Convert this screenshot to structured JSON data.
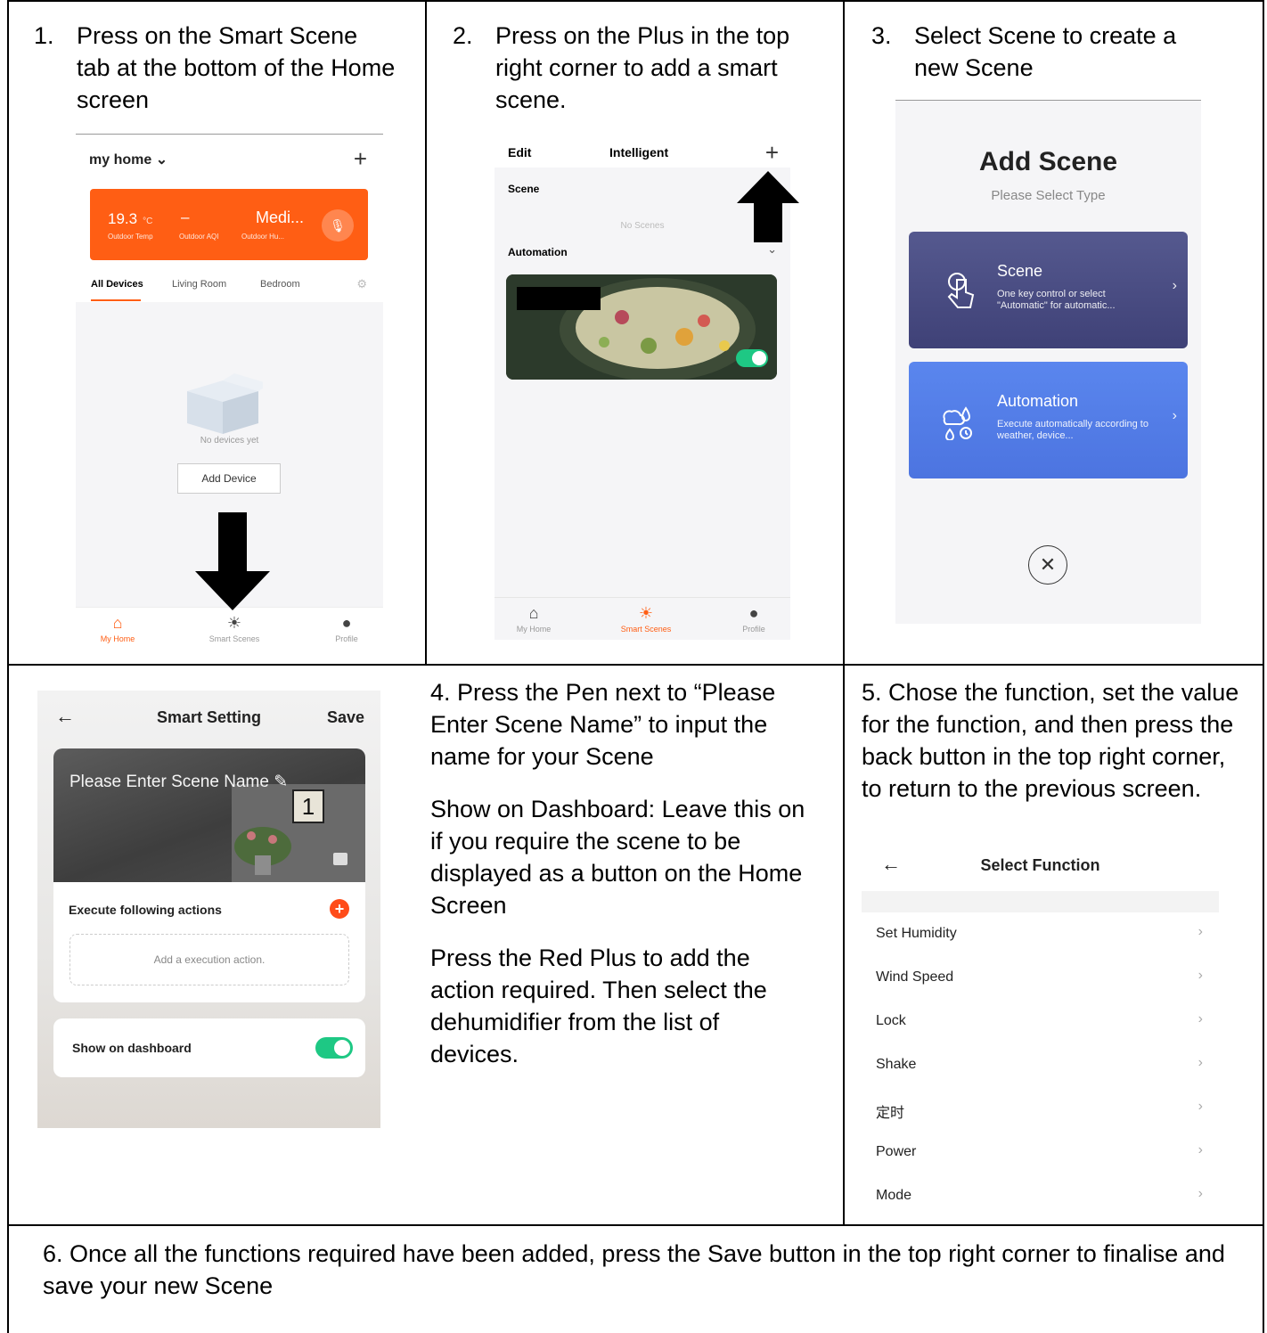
{
  "steps": {
    "s1": {
      "num": "1.",
      "text": "Press on the Smart Scene tab at the bottom of the Home screen"
    },
    "s2": {
      "num": "2.",
      "text": "Press on the Plus in the top right corner to add a smart scene."
    },
    "s3": {
      "num": "3.",
      "text": "Select Scene to create a new Scene"
    },
    "s4": {
      "p1": "4. Press the Pen next to “Please Enter Scene Name” to input the name for your Scene",
      "p2": "Show on Dashboard: Leave this on if you require the scene to be displayed as a button on the Home Screen",
      "p3": "Press the Red Plus to add the action required.  Then select the dehumidifier from the list of devices."
    },
    "s5": {
      "text": "5. Chose the function, set the value for the function, and then press the back button in the top right corner, to return to the previous screen."
    },
    "s6": {
      "text": "6.  Once all the functions required have been added, press the Save button in the top right corner to finalise and save your new Scene"
    }
  },
  "screen1": {
    "home_title": "my home",
    "temp": "19.3",
    "temp_unit": "°C",
    "aqi": "–",
    "humidity": "Medi...",
    "temp_label": "Outdoor Temp",
    "aqi_label": "Outdoor AQI",
    "hum_label": "Outdoor Hu...",
    "tabs": [
      "All Devices",
      "Living Room",
      "Bedroom"
    ],
    "empty_text": "No devices yet",
    "add_device": "Add Device",
    "nav": [
      "My Home",
      "Smart Scenes",
      "Profile"
    ]
  },
  "screen2": {
    "edit": "Edit",
    "title": "Intelligent",
    "scene_label": "Scene",
    "no_scenes": "No Scenes",
    "automation_label": "Automation",
    "nav": [
      "My Home",
      "Smart Scenes",
      "Profile"
    ]
  },
  "screen3": {
    "title": "Add Scene",
    "subtitle": "Please Select Type",
    "scene": {
      "name": "Scene",
      "desc": "One key control or select \"Automatic\" for automatic..."
    },
    "automation": {
      "name": "Automation",
      "desc": "Execute automatically according to weather, device..."
    }
  },
  "screen4": {
    "title": "Smart Setting",
    "save": "Save",
    "name_placeholder": "Please Enter Scene Name",
    "calendar_digit": "1",
    "execute_label": "Execute following actions",
    "add_action": "Add a execution action.",
    "dashboard_label": "Show on dashboard"
  },
  "screen5": {
    "title": "Select Function",
    "functions": [
      "Set Humidity",
      "Wind Speed",
      "Lock",
      "Shake",
      "定时",
      "Power",
      "Mode"
    ]
  },
  "colors": {
    "accent_orange": "#ff5e14",
    "toggle_green": "#1ec884",
    "scene_card": "#4a4d84",
    "automation_card": "#5580ea"
  }
}
